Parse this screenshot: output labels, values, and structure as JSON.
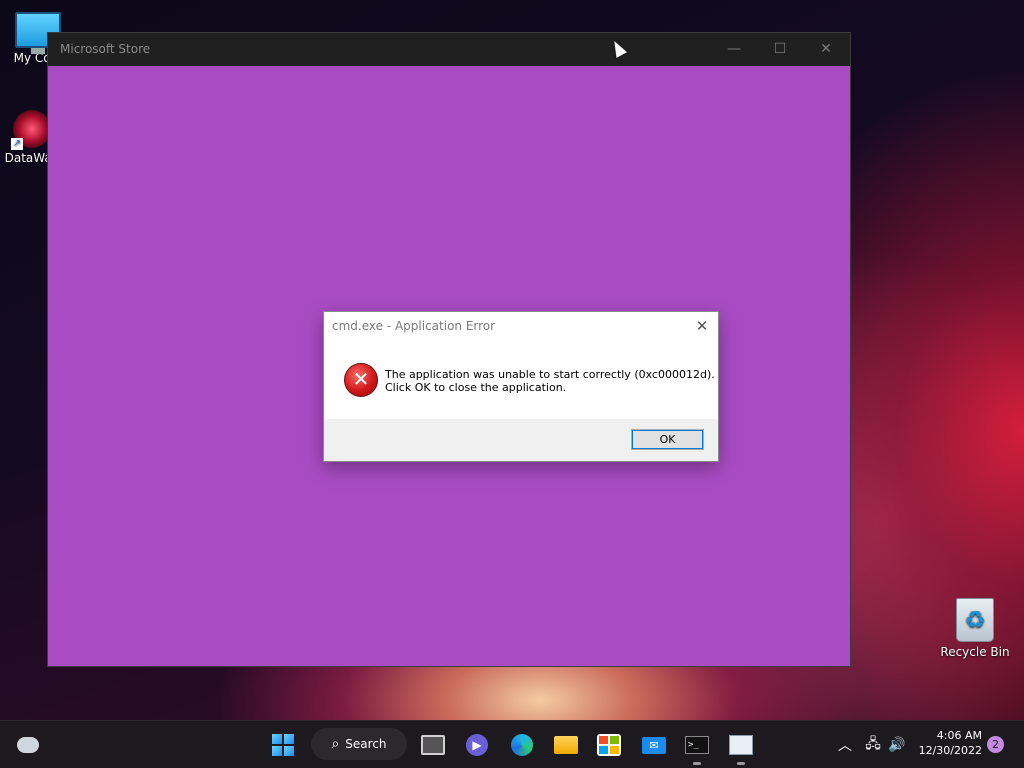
{
  "desktop": {
    "icons": [
      {
        "label": "My Com",
        "icon": "computer-icon"
      },
      {
        "label": "DataWag",
        "icon": "datawag-icon"
      },
      {
        "label": "Recycle Bin",
        "icon": "recycle-bin-icon"
      }
    ]
  },
  "store_window": {
    "title": "Microsoft Store",
    "minimize": "—",
    "maximize": "☐",
    "close": "✕",
    "background": "#a94cc4"
  },
  "dialog": {
    "title": "cmd.exe - Application Error",
    "close": "✕",
    "message_line1": "The application was unable to start correctly (0xc000012d).",
    "message_line2": "Click OK to close the application.",
    "icon": "error-icon",
    "ok_label": "OK"
  },
  "taskbar": {
    "search_label": "Search",
    "apps": [
      "start",
      "search",
      "task-view",
      "teams",
      "edge",
      "file-explorer",
      "microsoft-store",
      "mail",
      "command-prompt",
      "store-window"
    ],
    "clock_time": "4:06 AM",
    "clock_date": "12/30/2022",
    "notification_count": "2"
  },
  "colors": {
    "accent": "#0078d7",
    "error": "#d01818",
    "taskbar": "#1c1a1e"
  }
}
